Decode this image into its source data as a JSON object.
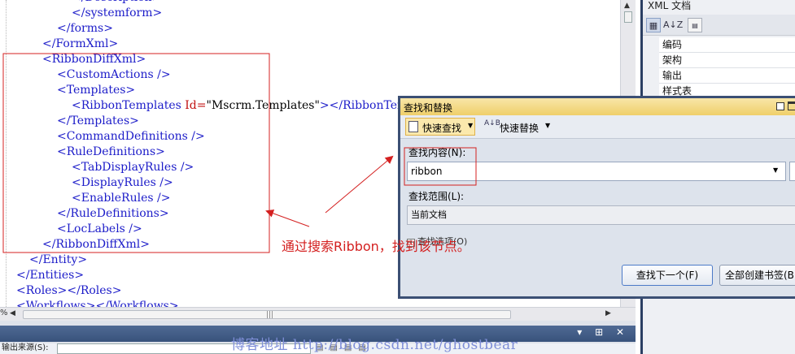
{
  "editor": {
    "lines": [
      {
        "indent": 88,
        "text": "</Description>"
      },
      {
        "indent": 88,
        "text": "</systemform>"
      },
      {
        "indent": 70,
        "text": "</forms>"
      },
      {
        "indent": 52,
        "text": "</FormXml>"
      },
      {
        "indent": 52,
        "text": "<RibbonDiffXml>"
      },
      {
        "indent": 70,
        "text": "<CustomActions />"
      },
      {
        "indent": 70,
        "text": "<Templates>"
      },
      {
        "indent": 88,
        "attr_line": true,
        "tag": "<RibbonTemplates ",
        "attr": "Id=",
        "quote_open": "\"",
        "value": "Mscrm.Templates",
        "quote_close": "\"",
        "rest": "></RibbonTempl"
      },
      {
        "indent": 70,
        "text": "</Templates>"
      },
      {
        "indent": 70,
        "text": "<CommandDefinitions />"
      },
      {
        "indent": 70,
        "text": "<RuleDefinitions>"
      },
      {
        "indent": 88,
        "text": "<TabDisplayRules />"
      },
      {
        "indent": 88,
        "text": "<DisplayRules />"
      },
      {
        "indent": 88,
        "text": "<EnableRules />"
      },
      {
        "indent": 70,
        "text": "</RuleDefinitions>"
      },
      {
        "indent": 70,
        "text": "<LocLabels />"
      },
      {
        "indent": 52,
        "text": "</RibbonDiffXml>"
      },
      {
        "indent": 36,
        "text": "</Entity>"
      },
      {
        "indent": 20,
        "text": "</Entities>"
      },
      {
        "indent": 20,
        "text": "<Roles></Roles>"
      },
      {
        "indent": 20,
        "text": "<Workflows></Workflows>"
      }
    ],
    "zoom": "%"
  },
  "output": {
    "source_label": "输出来源(S):",
    "controls": "▾ &#x2395; ✕"
  },
  "props": {
    "title": "XML 文档",
    "tool_sort": "A↓Z",
    "rows": [
      "编码",
      "架构",
      "输出",
      "样式表"
    ]
  },
  "find": {
    "title": "查找和替换",
    "quick_find": "快速查找",
    "quick_replace": "快速替换",
    "find_what_label": "查找内容(N):",
    "find_what_value": "ribbon",
    "scope_label": "查找范围(L):",
    "scope_value": "当前文档",
    "options_label": "查找选项(O)",
    "find_next": "查找下一个(F)",
    "bookmark_all": "全部创建书签(B)"
  },
  "annotation": {
    "text": "通过搜索Ribbon，找到该节点。",
    "color": "#d42020"
  },
  "watermark": "博客地址 http://blog.csdn.net/ghostbear"
}
